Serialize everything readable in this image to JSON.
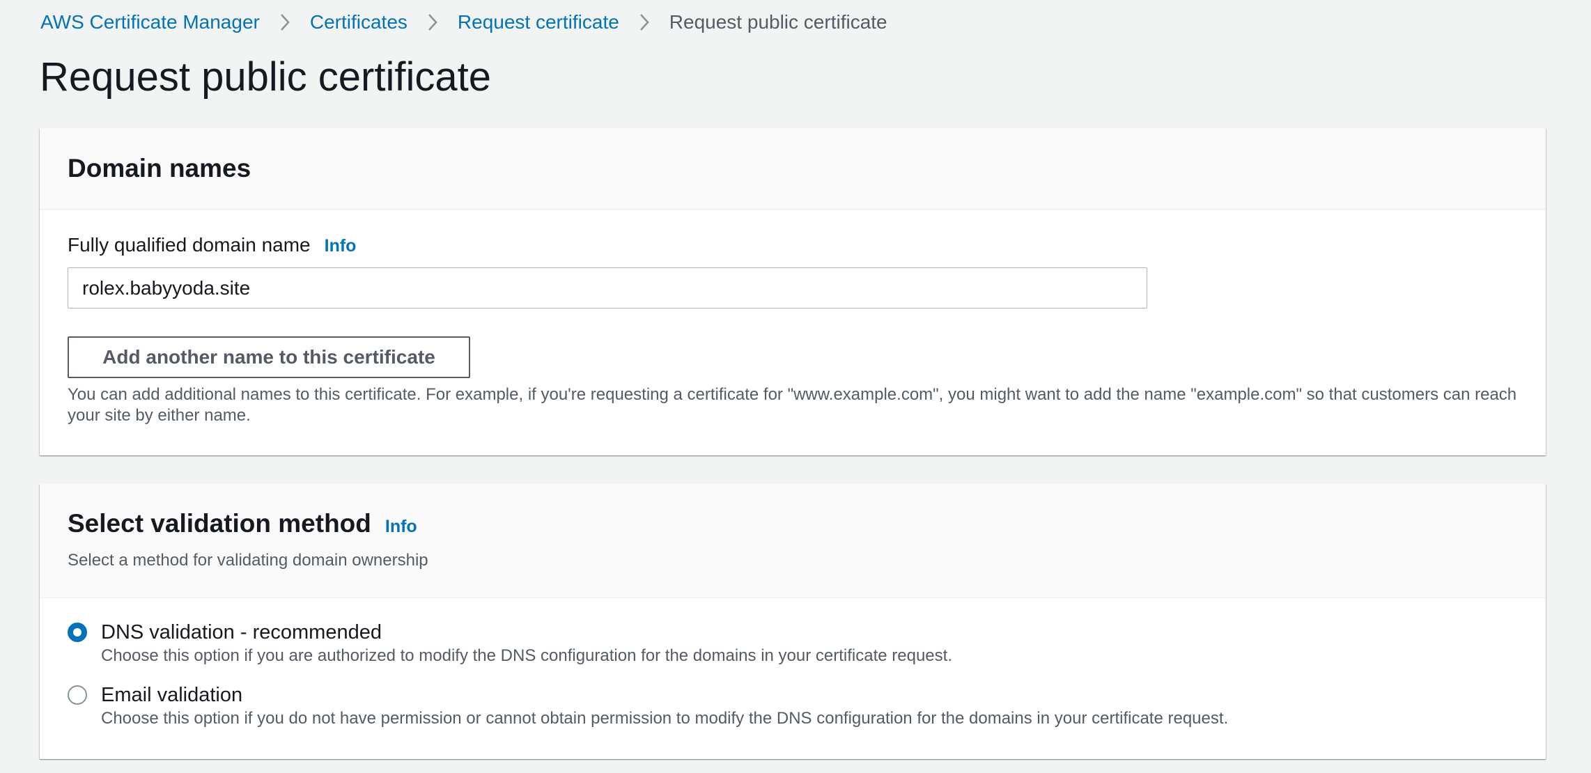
{
  "breadcrumb": {
    "items": [
      {
        "label": "AWS Certificate Manager"
      },
      {
        "label": "Certificates"
      },
      {
        "label": "Request certificate"
      },
      {
        "label": "Request public certificate"
      }
    ]
  },
  "page": {
    "title": "Request public certificate"
  },
  "domain_panel": {
    "title": "Domain names",
    "fqdn_label": "Fully qualified domain name",
    "info_label": "Info",
    "fqdn_value": "rolex.babyyoda.site",
    "add_name_button": "Add another name to this certificate",
    "help_text": "You can add additional names to this certificate. For example, if you're requesting a certificate for \"www.example.com\", you might want to add the name \"example.com\" so that customers can reach your site by either name."
  },
  "validation_panel": {
    "title": "Select validation method",
    "info_label": "Info",
    "description": "Select a method for validating domain ownership",
    "options": [
      {
        "label": "DNS validation - recommended",
        "description": "Choose this option if you are authorized to modify the DNS configuration for the domains in your certificate request.",
        "selected": true
      },
      {
        "label": "Email validation",
        "description": "Choose this option if you do not have permission or cannot obtain permission to modify the DNS configuration for the domains in your certificate request.",
        "selected": false
      }
    ]
  },
  "colors": {
    "link": "#0073bb",
    "text": "#16191f",
    "secondary_text": "#545b64",
    "background": "#f2f3f3"
  }
}
